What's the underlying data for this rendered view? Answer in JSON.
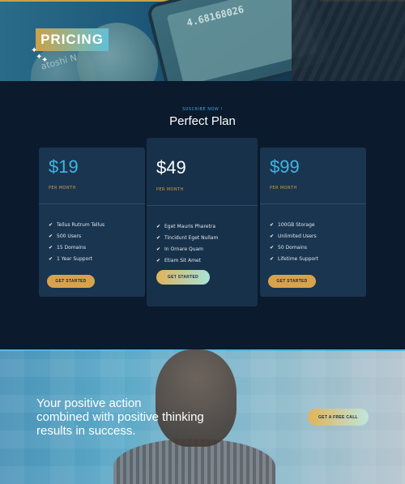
{
  "hero": {
    "badge": "PRICING",
    "sparkle_icon": "sparkle-icon",
    "background_text": {
      "screen_number": "4.68168026",
      "coin_engraving": "atoshi N"
    }
  },
  "pricing": {
    "eyebrow": "SUSCRIBE NOW !",
    "title": "Perfect Plan",
    "plans": [
      {
        "price": "$19",
        "period": "PER MONTH",
        "features": [
          "Tellus Rutrum Tellus",
          "500 Users",
          "15 Domains",
          "1 Year Support"
        ],
        "cta": "GET STARTED"
      },
      {
        "price": "$49",
        "period": "PER MONTH",
        "features": [
          "Eget Mauris Pharetra",
          "Tincidunt Eget Nullam",
          "In Ornare Quam",
          "Etiam Sit Amet"
        ],
        "cta": "GET STARTED"
      },
      {
        "price": "$99",
        "period": "PER MONTH",
        "features": [
          "100GB Storage",
          "Unlimited Users",
          "50 Domains",
          "Lifetime Support"
        ],
        "cta": "GET STARTED"
      }
    ],
    "check_icon": "check-icon",
    "colors": {
      "accent_blue": "#3fb5e6",
      "accent_gold": "#d8a24c",
      "card_bg": "#1a3550",
      "page_bg": "#0b1a2d"
    }
  },
  "banner": {
    "tagline_lines": [
      "Your positive action",
      "combined with positive thinking",
      "results in success."
    ],
    "cta": "GET A FREE CALL"
  }
}
